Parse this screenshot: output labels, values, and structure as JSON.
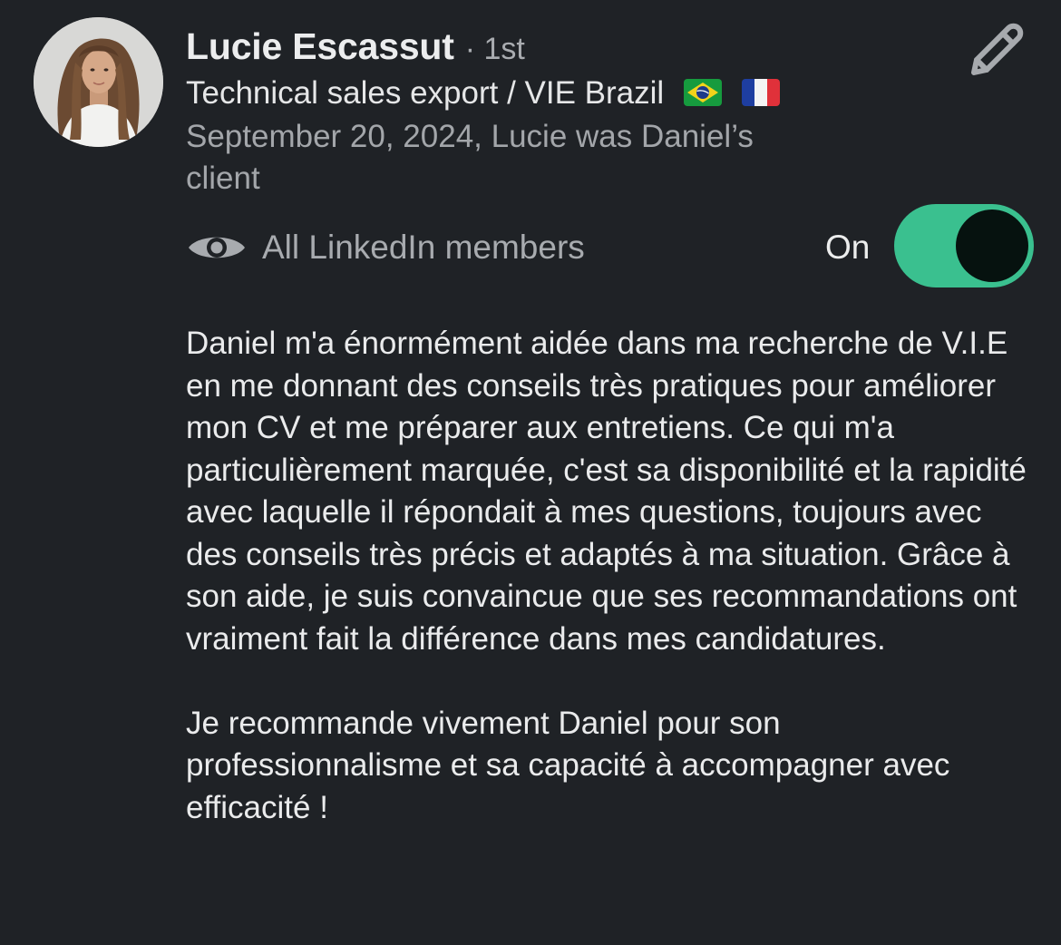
{
  "profile": {
    "name": "Lucie Escassut",
    "degree": "· 1st",
    "headline": "Technical sales export / VIE Brazil",
    "flags": [
      "brazil-flag-icon",
      "france-flag-icon"
    ],
    "relation": "September 20, 2024, Lucie was Daniel’s client"
  },
  "visibility": {
    "icon": "eye-icon",
    "label": "All LinkedIn members",
    "toggle_label": "On",
    "toggle_on": true,
    "accent_color": "#3ac08f"
  },
  "edit": {
    "icon": "pencil-icon"
  },
  "recommendation": {
    "paragraphs": [
      "Daniel m'a énormément aidée dans ma recherche de V.I.E en me donnant des conseils très pratiques pour améliorer mon CV et me préparer aux entretiens. Ce qui m'a particulièrement marquée, c'est sa disponibilité et la rapidité avec laquelle il répondait à mes questions, toujours avec des conseils très précis et adaptés à ma situation. Grâce à son aide, je suis convaincue que ses recommandations ont vraiment fait la différence dans mes candidatures.",
      "Je recommande vivement Daniel pour son professionnalisme et sa capacité à accompagner avec efficacité !"
    ]
  }
}
